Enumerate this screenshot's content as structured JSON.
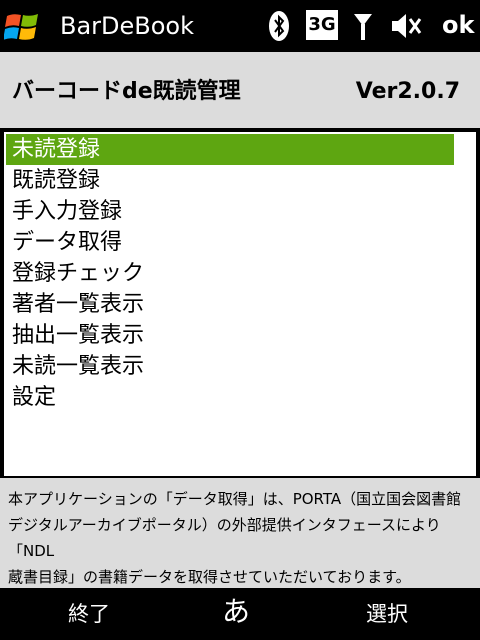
{
  "status_bar": {
    "app_title": "BarDeBook",
    "network_label": "3G",
    "ok_label": "ok"
  },
  "header": {
    "title": "バーコードde既読管理",
    "version": "Ver2.0.7"
  },
  "menu": {
    "items": [
      {
        "label": "未読登録"
      },
      {
        "label": "既読登録"
      },
      {
        "label": "手入力登録"
      },
      {
        "label": "データ取得"
      },
      {
        "label": "登録チェック"
      },
      {
        "label": "著者一覧表示"
      },
      {
        "label": "抽出一覧表示"
      },
      {
        "label": "未読一覧表示"
      },
      {
        "label": "設定"
      }
    ],
    "selected_index": 0
  },
  "info": {
    "line1": "本アプリケーションの「データ取得」は、PORTA（国立国会図書館",
    "line2": "デジタルアーカイブポータル）の外部提供インタフェースにより「NDL",
    "line3": "蔵書目録」の書籍データを取得させていただいております。"
  },
  "softkeys": {
    "left": "終了",
    "center": "あ",
    "right": "選択"
  },
  "colors": {
    "selection": "#5ea611",
    "panel_bg": "#dcdcdc",
    "bar_bg": "#000000"
  }
}
